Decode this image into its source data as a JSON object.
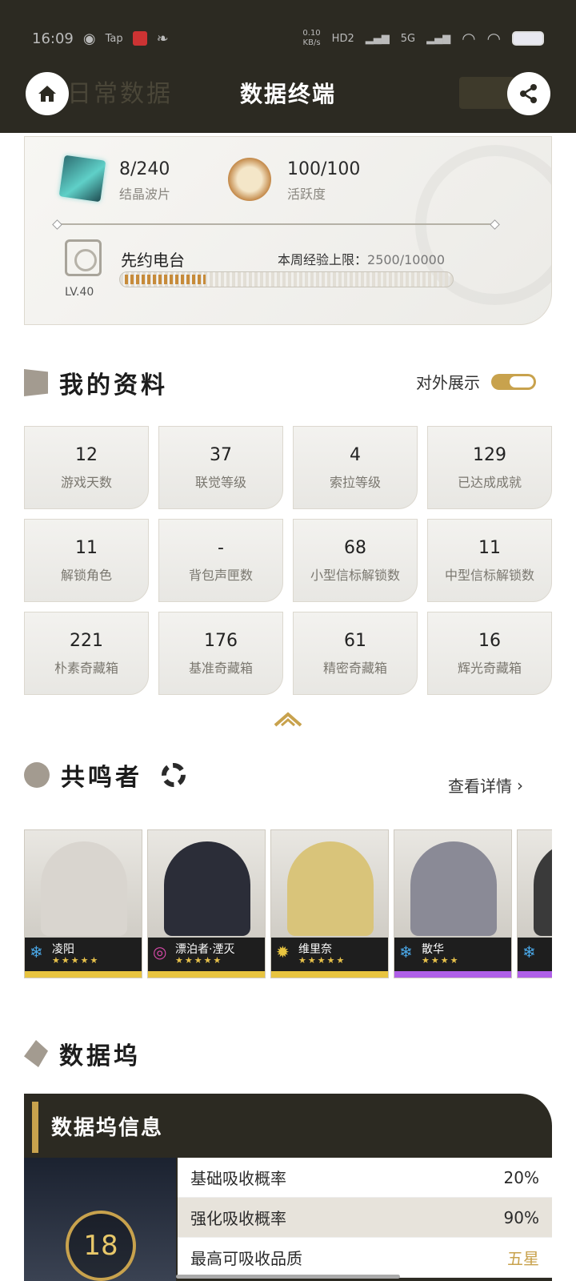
{
  "status": {
    "time": "16:09",
    "net_speed": "0.10",
    "net_unit": "KB/s",
    "net1": "HD2",
    "net2": "5G"
  },
  "header": {
    "title": "数据终端",
    "ghost_title": "日常数据"
  },
  "resources": {
    "crystal": {
      "value": "8/240",
      "label": "结晶波片"
    },
    "activity": {
      "value": "100/100",
      "label": "活跃度"
    }
  },
  "station": {
    "name": "先约电台",
    "level": "LV.40",
    "exp_label": "本周经验上限：",
    "exp_value": "2500/10000",
    "exp_progress": 0.25
  },
  "profile": {
    "title": "我的资料",
    "toggle_label": "对外展示",
    "stats": [
      {
        "value": "12",
        "label": "游戏天数"
      },
      {
        "value": "37",
        "label": "联觉等级"
      },
      {
        "value": "4",
        "label": "索拉等级"
      },
      {
        "value": "129",
        "label": "已达成成就"
      },
      {
        "value": "11",
        "label": "解锁角色"
      },
      {
        "value": "-",
        "label": "背包声匣数"
      },
      {
        "value": "68",
        "label": "小型信标解锁数"
      },
      {
        "value": "11",
        "label": "中型信标解锁数"
      },
      {
        "value": "221",
        "label": "朴素奇藏箱"
      },
      {
        "value": "176",
        "label": "基准奇藏箱"
      },
      {
        "value": "61",
        "label": "精密奇藏箱"
      },
      {
        "value": "16",
        "label": "辉光奇藏箱"
      }
    ]
  },
  "resonators": {
    "title": "共鸣者",
    "details_label": "查看详情",
    "list": [
      {
        "name": "凌阳",
        "stars": "★★★★★",
        "element_icon": "glacio-icon",
        "stripe": "#e8c440",
        "art": "#d9d5cf",
        "icon_glyph": "❄",
        "icon_color": "#4aa8e8"
      },
      {
        "name": "漂泊者·湮灭",
        "stars": "★★★★★",
        "element_icon": "havoc-icon",
        "stripe": "#e8c440",
        "art": "#2b2d38",
        "icon_glyph": "◎",
        "icon_color": "#d64aa8"
      },
      {
        "name": "维里奈",
        "stars": "★★★★★",
        "element_icon": "spectro-icon",
        "stripe": "#e8c440",
        "art": "#d9c47a",
        "icon_glyph": "✹",
        "icon_color": "#e8c440"
      },
      {
        "name": "散华",
        "stars": "★★★★",
        "element_icon": "glacio-icon",
        "stripe": "#b060e8",
        "art": "#8a8a96",
        "icon_glyph": "❄",
        "icon_color": "#4aa8e8"
      },
      {
        "name": "",
        "stars": "",
        "element_icon": "glacio-icon",
        "stripe": "#b060e8",
        "art": "#3a3a3a",
        "icon_glyph": "❄",
        "icon_color": "#4aa8e8"
      }
    ]
  },
  "databank": {
    "title": "数据坞",
    "info_title": "数据坞信息",
    "level": "18",
    "rows": [
      {
        "label": "基础吸收概率",
        "value": "20%"
      },
      {
        "label": "强化吸收概率",
        "value": "90%"
      },
      {
        "label": "最高可吸收品质",
        "value": "五星"
      }
    ]
  },
  "colors": {
    "header_bg": "#2c2a22",
    "accent_gold": "#c8a24d"
  }
}
